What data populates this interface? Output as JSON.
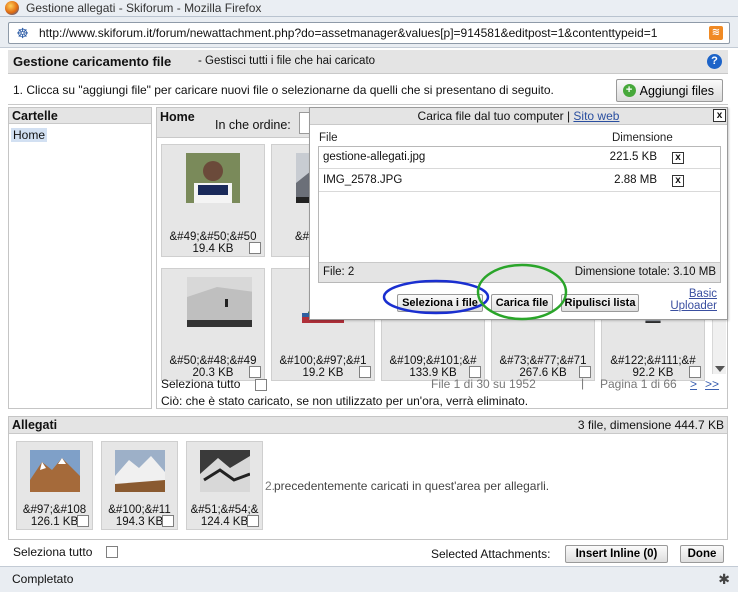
{
  "window": {
    "title": "Gestione allegati - Skiforum - Mozilla Firefox"
  },
  "urlbar": {
    "url": "http://www.skiforum.it/forum/newattachment.php?do=assetmanager&values[p]=914581&editpost=1&contenttypeid=1"
  },
  "header": {
    "title": "Gestione caricamento file",
    "subtitle": "- Gestisci tutti i file che hai caricato"
  },
  "instructions": {
    "text": "1. Clicca su \"aggiungi file\" per caricare nuovi file o selezionarne da quelli che si presentano di seguito.",
    "add_button": "Aggiungi files"
  },
  "folders": {
    "title": "Cartelle",
    "items": [
      "Home"
    ]
  },
  "main": {
    "folder": "Home",
    "order_label": "In che ordine:",
    "thumbs": [
      {
        "name": "&#49;&#50;&#50",
        "size": "19.4 KB"
      },
      {
        "name": "&#114;&#1",
        "size": ""
      },
      {
        "name": "&#50;&#48;&#49",
        "size": "20.3 KB"
      },
      {
        "name": "&#100;&#97;&#1",
        "size": "19.2 KB"
      },
      {
        "name": "&#109;&#101;&#",
        "size": "133.9 KB"
      },
      {
        "name": "&#73;&#77;&#71",
        "size": "267.6 KB"
      },
      {
        "name": "&#122;&#111;&#",
        "size": "92.2 KB"
      }
    ],
    "select_all": "Seleziona tutto",
    "file_count": "File 1 di 30 su 1952",
    "pagination": "Pagina 1 di 66",
    "next": ">",
    "last": ">>",
    "note": "Ciò: che è stato caricato, se non utilizzato per un'ora, verrà eliminato."
  },
  "upload_popup": {
    "title": "Carica file dal tuo computer",
    "title_sep": "|",
    "alt_link": "Sito web",
    "col_file": "File",
    "col_size": "Dimensione",
    "files": [
      {
        "name": "gestione-allegati.jpg",
        "size": "221.5 KB"
      },
      {
        "name": "IMG_2578.JPG",
        "size": "2.88 MB"
      }
    ],
    "files_count": "File: 2",
    "total_size": "Dimensione totale: 3.10 MB",
    "select_button": "Seleziona i file",
    "upload_button": "Carica file",
    "clear_button": "Ripulisci lista",
    "basic_line1": "Basic",
    "basic_line2": "Uploader",
    "close": "x",
    "remove": "x"
  },
  "attachments": {
    "title": "Allegati",
    "summary": "3 file, dimensione 444.7 KB",
    "items": [
      {
        "name": "&#97;&#108",
        "size": "126.1 KB"
      },
      {
        "name": "&#100;&#11",
        "size": "194.3 KB"
      },
      {
        "name": "&#51;&#54;&",
        "size": "124.4 KB"
      }
    ],
    "hint_prefix": "2.",
    "hint": "precedentemente caricati in quest'area per allegarli."
  },
  "footer": {
    "select_all": "Seleziona tutto",
    "selected_label": "Selected Attachments:",
    "insert_inline": "Insert Inline (0)",
    "done": "Done"
  },
  "status": {
    "text": "Completato"
  },
  "colors": {
    "highlight_blue": "#1a2fd0",
    "highlight_green": "#2aa52a"
  }
}
